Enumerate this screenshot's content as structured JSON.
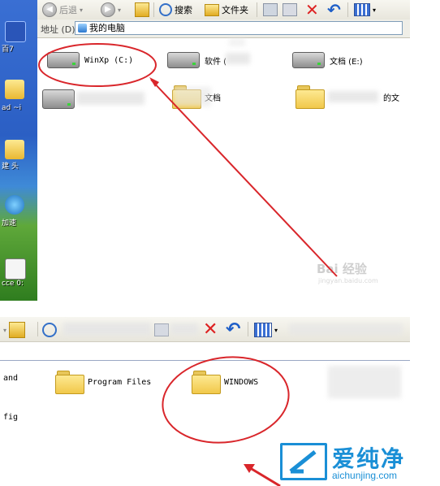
{
  "top": {
    "desktop": {
      "labels": [
        "百7",
        "ad  ~i",
        "建  头",
        "加速",
        "cce  0:"
      ]
    },
    "toolbar": {
      "back_label": "后退",
      "search_label": "搜索",
      "folders_label": "文件夹"
    },
    "address": {
      "label": "地址 (D)",
      "value": "我的电脑"
    },
    "drives": [
      {
        "label": "WinXp (C:)"
      },
      {
        "label": "软件 ("
      },
      {
        "label": "文档 (E:)"
      }
    ],
    "folders": [
      {
        "label": "文档"
      },
      {
        "label": "的文"
      }
    ],
    "watermark": {
      "brand": "Bai 经验",
      "url": "jingyan.baidu.com"
    }
  },
  "bottom": {
    "side_labels": [
      "and",
      "fig"
    ],
    "folders": [
      {
        "label": "Program Files"
      },
      {
        "label": "WINDOWS"
      }
    ]
  },
  "logo": {
    "main": "爱纯净",
    "url": "aichunjing.com"
  },
  "colors": {
    "annotation_red": "#d9262b",
    "logo_blue": "#1a8fd6"
  }
}
